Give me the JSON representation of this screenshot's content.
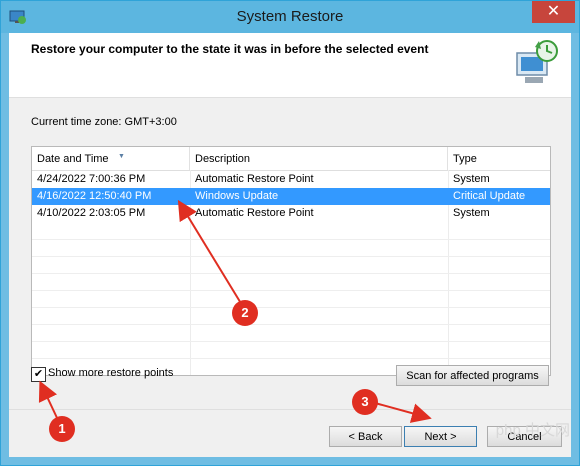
{
  "window": {
    "title": "System Restore",
    "close_glyph": "✕"
  },
  "header": {
    "text": "Restore your computer to the state it was in before the selected event",
    "icon": "system-restore-icon"
  },
  "timezone_text": "Current time zone: GMT+3:00",
  "table": {
    "columns": [
      "Date and Time",
      "Description",
      "Type"
    ],
    "rows": [
      {
        "date": "4/24/2022 7:00:36 PM",
        "desc": "Automatic Restore Point",
        "type": "System",
        "selected": false
      },
      {
        "date": "4/16/2022 12:50:40 PM",
        "desc": "Windows Update",
        "type": "Critical Update",
        "selected": true
      },
      {
        "date": "4/10/2022 2:03:05 PM",
        "desc": "Automatic Restore Point",
        "type": "System",
        "selected": false
      }
    ]
  },
  "show_more": {
    "label": "Show more restore points",
    "checked": true,
    "check_glyph": "✔"
  },
  "buttons": {
    "scan": "Scan for affected programs",
    "back": "< Back",
    "next": "Next >",
    "cancel": "Cancel"
  },
  "annotations": [
    "1",
    "2",
    "3"
  ],
  "watermark": "php 中文网",
  "colors": {
    "selection": "#3399ff",
    "annotation": "#e02e21",
    "titlebar": "#5cb6e0"
  }
}
